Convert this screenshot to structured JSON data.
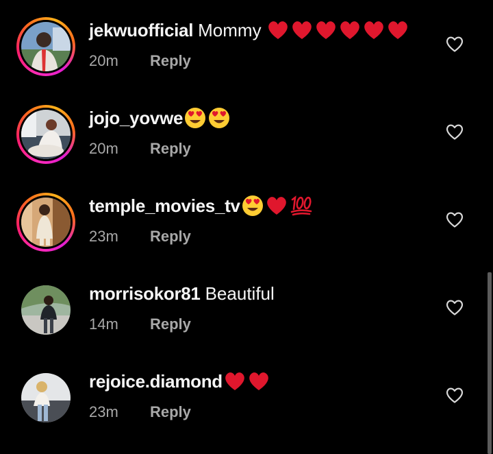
{
  "comments": [
    {
      "username": "jekwuofficial",
      "text": "Mommy",
      "emojis": [
        "red-heart",
        "red-heart",
        "red-heart",
        "red-heart",
        "red-heart",
        "red-heart"
      ],
      "time": "20m",
      "reply_label": "Reply",
      "story_ring": true
    },
    {
      "username": "jojo_yovwe",
      "text": "",
      "emojis": [
        "heart-eyes",
        "heart-eyes"
      ],
      "time": "20m",
      "reply_label": "Reply",
      "story_ring": true
    },
    {
      "username": "temple_movies_tv",
      "text": "",
      "emojis": [
        "heart-eyes",
        "red-heart",
        "hundred-points"
      ],
      "time": "23m",
      "reply_label": "Reply",
      "story_ring": true
    },
    {
      "username": "morrisokor81",
      "text": "Beautiful",
      "emojis": [],
      "time": "14m",
      "reply_label": "Reply",
      "story_ring": false
    },
    {
      "username": "rejoice.diamond",
      "text": "",
      "emojis": [
        "red-heart",
        "red-heart"
      ],
      "time": "23m",
      "reply_label": "Reply",
      "story_ring": false
    }
  ],
  "colors": {
    "background": "#000000",
    "username": "#f5f5f5",
    "meta": "#a8a8a8",
    "heart": "#e0172d"
  },
  "icons": {
    "like": "heart-outline-icon"
  }
}
